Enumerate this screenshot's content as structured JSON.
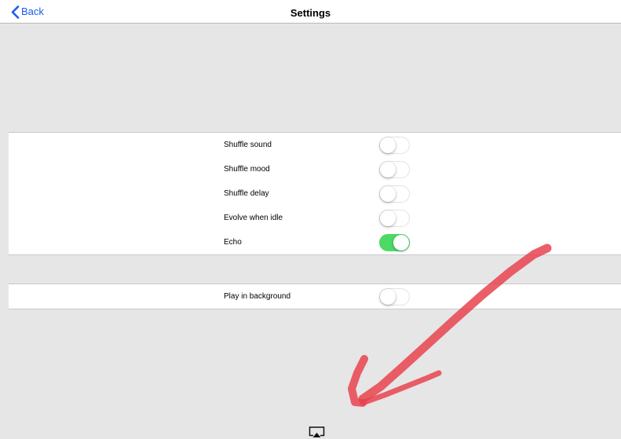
{
  "navbar": {
    "back_label": "Back",
    "title": "Settings"
  },
  "groups": [
    {
      "rows": [
        {
          "label": "Shuffle sound",
          "on": false
        },
        {
          "label": "Shuffle mood",
          "on": false
        },
        {
          "label": "Shuffle delay",
          "on": false
        },
        {
          "label": "Evolve when idle",
          "on": false
        },
        {
          "label": "Echo",
          "on": true
        }
      ]
    },
    {
      "rows": [
        {
          "label": "Play in background",
          "on": false
        }
      ]
    }
  ],
  "footer": {
    "airplay_icon": "airplay-icon"
  },
  "colors": {
    "background": "#e6e6e6",
    "accent": "#1a5cf0",
    "switch_on": "#4cd964",
    "annotation_arrow": "#e8434f"
  }
}
